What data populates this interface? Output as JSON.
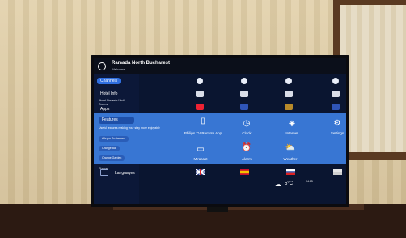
{
  "hotel": {
    "name": "Ramada North Bucharest",
    "welcome": "Welcome"
  },
  "menu": {
    "channels": "Channels",
    "hotel_info": "Hotel Info",
    "about": "About Ramada North",
    "rooms": "Rooms",
    "apps": "Apps",
    "features": "Features",
    "useful": "Useful features making your stay more enjoyable",
    "allegro": "Allegro Restaurant",
    "orange_bar": "Orange Bar",
    "orange_garden": "Orange Garden",
    "choose": "Choose",
    "languages": "Languages"
  },
  "features": {
    "philips": "Philips TV Remote App",
    "clock": "Clock",
    "internet": "Internet",
    "settings": "Settings",
    "miracast": "Miracast",
    "alarm": "Alarm",
    "weather": "Weather"
  },
  "weather": {
    "temp": "5°C",
    "time": "14:13"
  },
  "colors": {
    "band": "#3876d3",
    "screen": "#0a1530",
    "highlight": "#2f6fe0"
  }
}
